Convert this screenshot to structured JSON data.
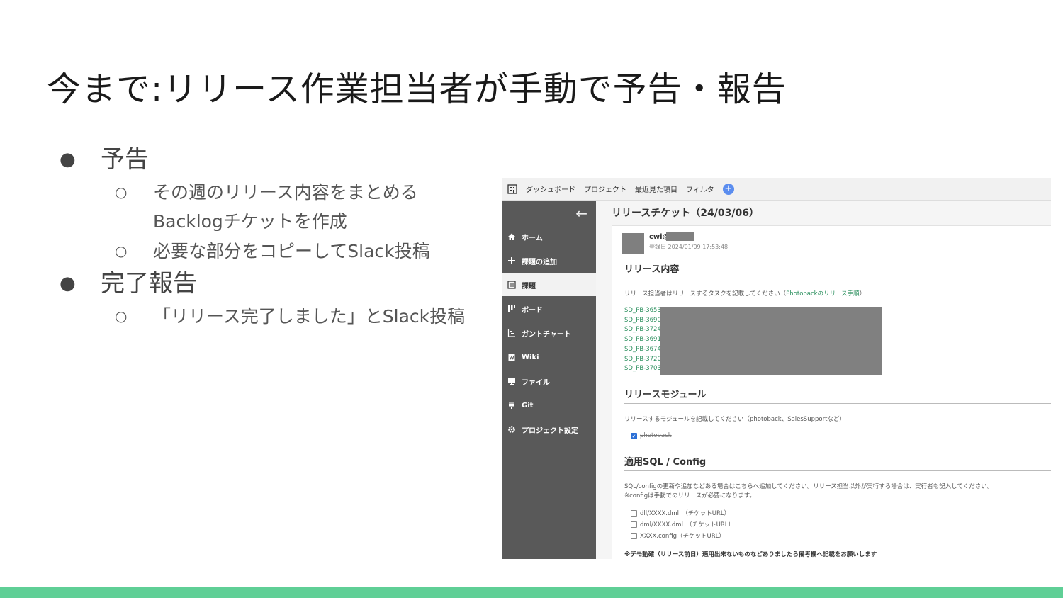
{
  "slide": {
    "title": "今まで:リリース作業担当者が手動で予告・報告",
    "bullets": [
      {
        "label": "予告",
        "subs": [
          "その週のリリース内容をまとめる Backlogチケットを作成",
          "必要な部分をコピーしてSlack投稿"
        ]
      },
      {
        "label": "完了報告",
        "subs": [
          "「リリース完了しました」とSlack投稿"
        ]
      }
    ]
  },
  "screenshot": {
    "topnav": {
      "items": [
        "ダッシュボード",
        "プロジェクト",
        "最近見た項目",
        "フィルタ"
      ],
      "plus_label": "+"
    },
    "sidebar": {
      "back_label": "←",
      "items": [
        {
          "label": "ホーム",
          "icon": "home-icon"
        },
        {
          "label": "課題の追加",
          "icon": "plus-icon"
        },
        {
          "label": "課題",
          "icon": "list-icon"
        },
        {
          "label": "ボード",
          "icon": "board-icon"
        },
        {
          "label": "ガントチャート",
          "icon": "gantt-icon"
        },
        {
          "label": "Wiki",
          "icon": "wiki-icon"
        },
        {
          "label": "ファイル",
          "icon": "file-icon"
        },
        {
          "label": "Git",
          "icon": "git-icon"
        },
        {
          "label": "プロジェクト設定",
          "icon": "gear-icon"
        }
      ]
    },
    "ticket": {
      "title": "リリースチケット（24/03/06）",
      "user": "cwi@",
      "registered": "登録日 2024/01/09 17:53:48",
      "sections": {
        "release_contents": "リリース内容",
        "release_contents_note": "リリース担当者はリリースするタスクを記載してください（",
        "release_contents_link": "Photobackのリリース手順",
        "release_contents_close": "）",
        "tickets": [
          "SD_PB-3653",
          "SD_PB-3690",
          "SD_PB-3724",
          "SD_PB-3691",
          "SD_PB-3674",
          "SD_PB-3720",
          "SD_PB-3703"
        ],
        "modules": "リリースモジュール",
        "modules_note": "リリースするモジュールを記載してください（photoback、SalesSupportなど）",
        "module_checked": "photoback",
        "sql": "適用SQL / Config",
        "sql_note_1": "SQL/configの更新や追加などある場合はこちらへ追加してください。リリース担当以外が実行する場合は、実行者も記入してください。",
        "sql_note_2": "※configは手動でのリリースが必要になります。",
        "sql_items": [
          "dll/XXXX.dml　（チケットURL）",
          "dml/XXXX.dml　（チケットURL）",
          "XXXX.config（チケットURL）"
        ],
        "footnote": "※デモ動確（リリース前日）適用出来ないものなどありましたら備考欄へ記載をお願いします"
      }
    }
  }
}
